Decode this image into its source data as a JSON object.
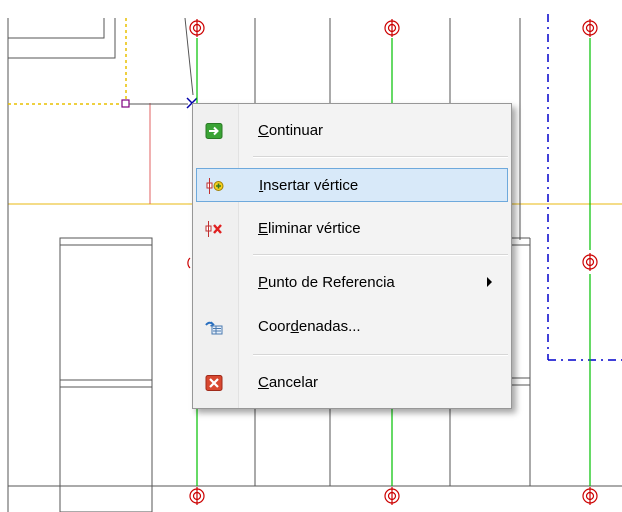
{
  "context_menu": {
    "items": [
      {
        "key": "C",
        "rest": "ontinuar",
        "prefix": "",
        "icon": "green-arrow-icon"
      },
      {
        "key": "I",
        "rest": "nsertar vértice",
        "prefix": "",
        "icon": "insert-vertex-icon",
        "highlighted": true
      },
      {
        "key": "E",
        "rest": "liminar vértice",
        "prefix": "",
        "icon": "delete-vertex-icon"
      },
      {
        "key": "P",
        "rest": "unto de Referencia",
        "prefix": "",
        "icon": "none",
        "submenu": true
      },
      {
        "key": "d",
        "rest": "enadas...",
        "prefix": "Coor",
        "icon": "coordinates-icon"
      },
      {
        "key": "C",
        "rest": "ancelar",
        "prefix": "",
        "icon": "cancel-icon"
      }
    ]
  },
  "colors": {
    "grid_line_green": "#00c000",
    "axis_yellow": "#f0d060",
    "boundary_blue": "#0000cc",
    "column_marker_red": "#cc0000",
    "highlight_bg": "#d8e9f9",
    "highlight_border": "#6ea9dc"
  }
}
